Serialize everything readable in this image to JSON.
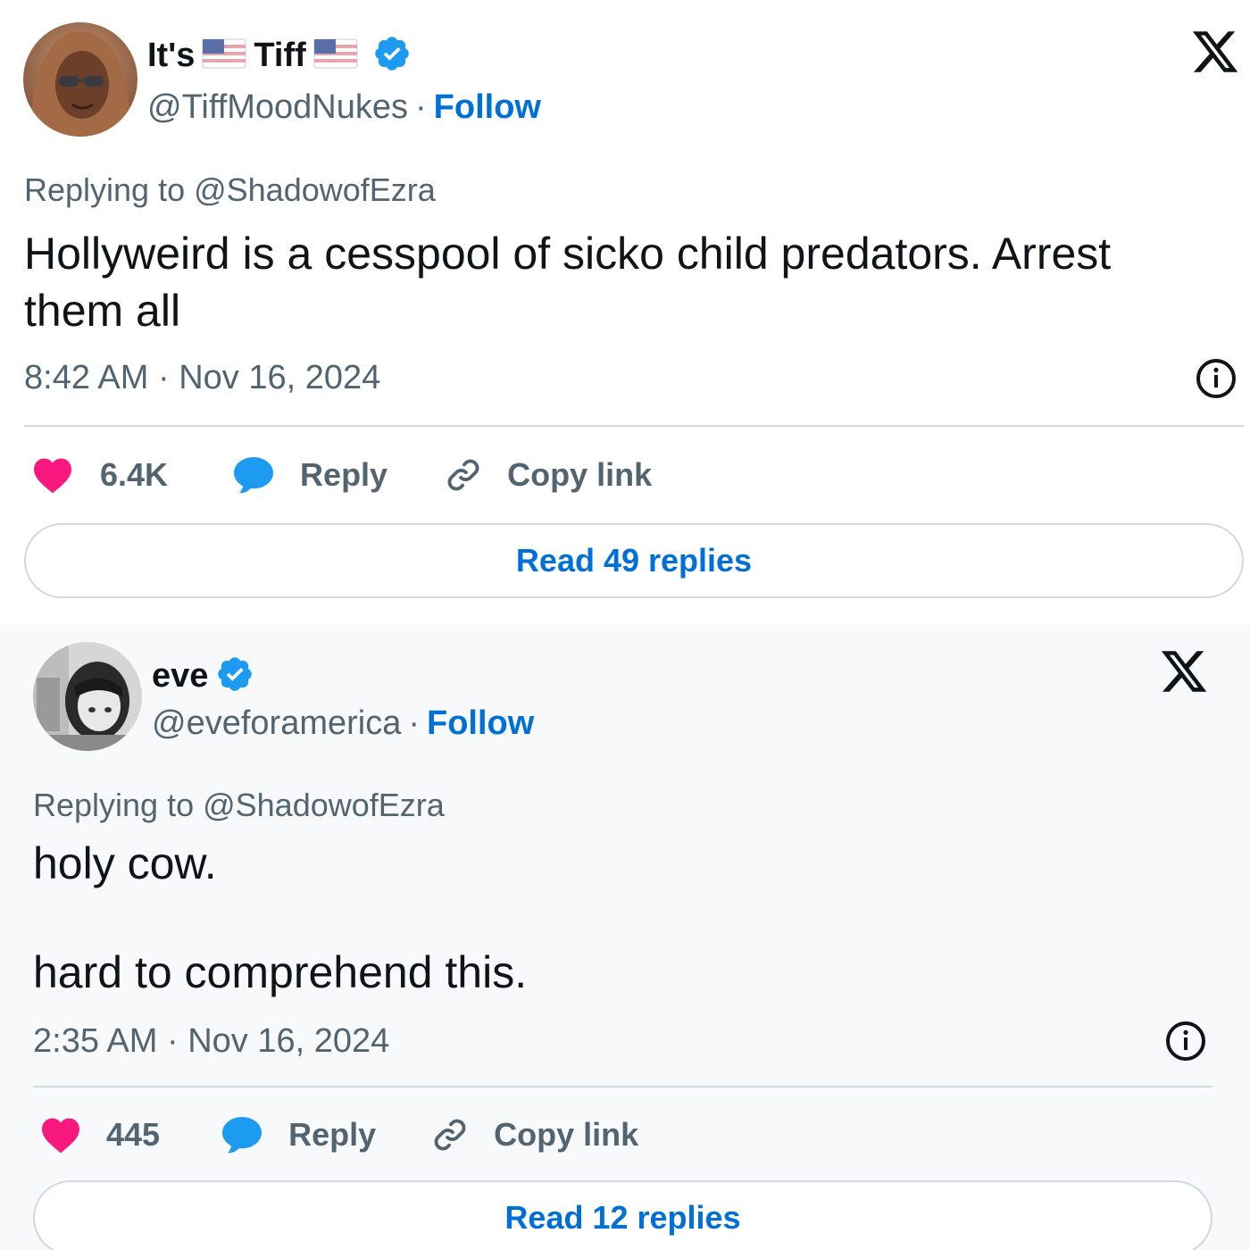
{
  "colors": {
    "link_blue": "#006fd6",
    "verified_blue": "#1d9bf0",
    "like_pink": "#f91880",
    "reply_blue": "#1d9bf0",
    "muted_gray": "#536471",
    "divider": "#cfd9de"
  },
  "tweets": [
    {
      "name_part1": "It's",
      "name_part2": "Tiff",
      "name_icons": [
        "us-flag-icon",
        "us-flag-icon",
        "verified-badge-icon"
      ],
      "handle": "@TiffMoodNukes",
      "separator": "·",
      "follow_label": "Follow",
      "replying_to": "Replying to @ShadowofEzra",
      "body": "Hollyweird is a cesspool of sicko child predators. Arrest them all",
      "timestamp": "8:42 AM · Nov 16, 2024",
      "likes": "6.4K",
      "reply_label": "Reply",
      "copy_link_label": "Copy link",
      "read_replies_label": "Read 49 replies"
    },
    {
      "name_part1": "eve",
      "name_icons": [
        "verified-badge-icon"
      ],
      "handle": "@eveforamerica",
      "separator": "·",
      "follow_label": "Follow",
      "replying_to": "Replying to @ShadowofEzra",
      "body": "holy cow.\n\nhard to comprehend this.",
      "timestamp": "2:35 AM · Nov 16, 2024",
      "likes": "445",
      "reply_label": "Reply",
      "copy_link_label": "Copy link",
      "read_replies_label": "Read 12 replies"
    }
  ]
}
